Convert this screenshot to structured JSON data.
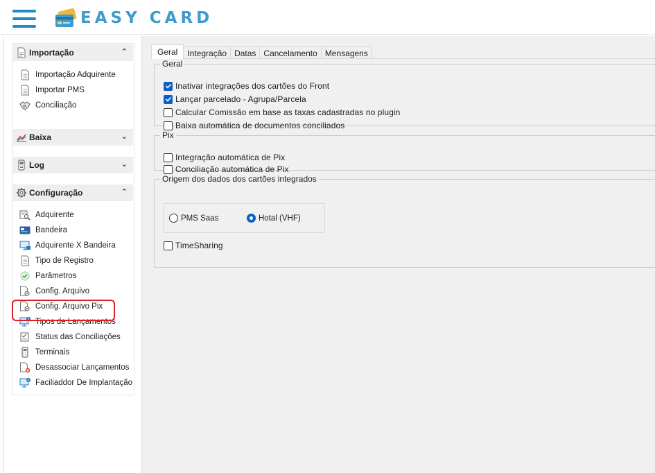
{
  "header": {
    "brand": "EASY CARD",
    "menu_icon": "hamburger-icon",
    "logo_icon": "credit-card-icon",
    "brand_color": "#3d9bd0"
  },
  "sidebar": {
    "groups": [
      {
        "label": "Importação",
        "icon": "import-icon",
        "expanded": true,
        "items": [
          {
            "label": "Importação Adquirente",
            "icon": "document-icon"
          },
          {
            "label": "Importar PMS",
            "icon": "document-icon"
          },
          {
            "label": "Conciliação",
            "icon": "handshake-icon"
          }
        ]
      },
      {
        "label": "Baixa",
        "icon": "chart-icon",
        "expanded": false,
        "items": []
      },
      {
        "label": "Log",
        "icon": "phone-icon",
        "expanded": false,
        "items": []
      },
      {
        "label": "Configuração",
        "icon": "gear-icon",
        "expanded": true,
        "items": [
          {
            "label": "Adquirente",
            "icon": "search-doc-icon"
          },
          {
            "label": "Bandeira",
            "icon": "card-icon"
          },
          {
            "label": "Adquirente X Bandeira",
            "icon": "monitor-icon"
          },
          {
            "label": "Tipo de Registro",
            "icon": "document-icon"
          },
          {
            "label": "Parâmetros",
            "icon": "check-circle-icon"
          },
          {
            "label": "Config. Arquivo",
            "icon": "file-gear-icon"
          },
          {
            "label": "Config. Arquivo Pix",
            "icon": "file-gear-icon"
          },
          {
            "label": "Tipos de Lançamentos",
            "icon": "monitor-info-icon"
          },
          {
            "label": "Status das Conciliações",
            "icon": "status-icon"
          },
          {
            "label": "Terminais",
            "icon": "terminal-icon"
          },
          {
            "label": "Desassociar Lançamentos",
            "icon": "doc-remove-icon"
          },
          {
            "label": "Faciliaddor De Implantação",
            "icon": "monitor-info-icon"
          }
        ]
      }
    ],
    "highlight_color": "#e02020"
  },
  "tabs": [
    "Geral",
    "Integração",
    "Datas",
    "Cancelamento",
    "Mensagens"
  ],
  "active_tab": "Geral",
  "geral": {
    "legend": "Geral",
    "options": [
      {
        "label": "Inativar integrações dos cartões do Front",
        "checked": true
      },
      {
        "label": "Lançar parcelado - Agrupa/Parcela",
        "checked": true
      },
      {
        "label": "Calcular Comissão em base as taxas cadastradas no plugin",
        "checked": false
      },
      {
        "label": "Baixa automática de documentos conciliados",
        "checked": false
      }
    ]
  },
  "pix": {
    "legend": "Pix",
    "options": [
      {
        "label": "Integração automática de Pix",
        "checked": false
      },
      {
        "label": "Conciliação automática de Pix",
        "checked": false
      }
    ]
  },
  "origem": {
    "legend": "Origem dos dados dos cartões integrados",
    "radios": [
      {
        "label": "PMS Saas",
        "checked": false
      },
      {
        "label": "Hotal (VHF)",
        "checked": true
      }
    ],
    "timesharing": {
      "label": "TimeSharing",
      "checked": false
    }
  },
  "colors": {
    "checkbox_checked": "#0a5fc4",
    "panel_bg": "#f0f0f0"
  }
}
